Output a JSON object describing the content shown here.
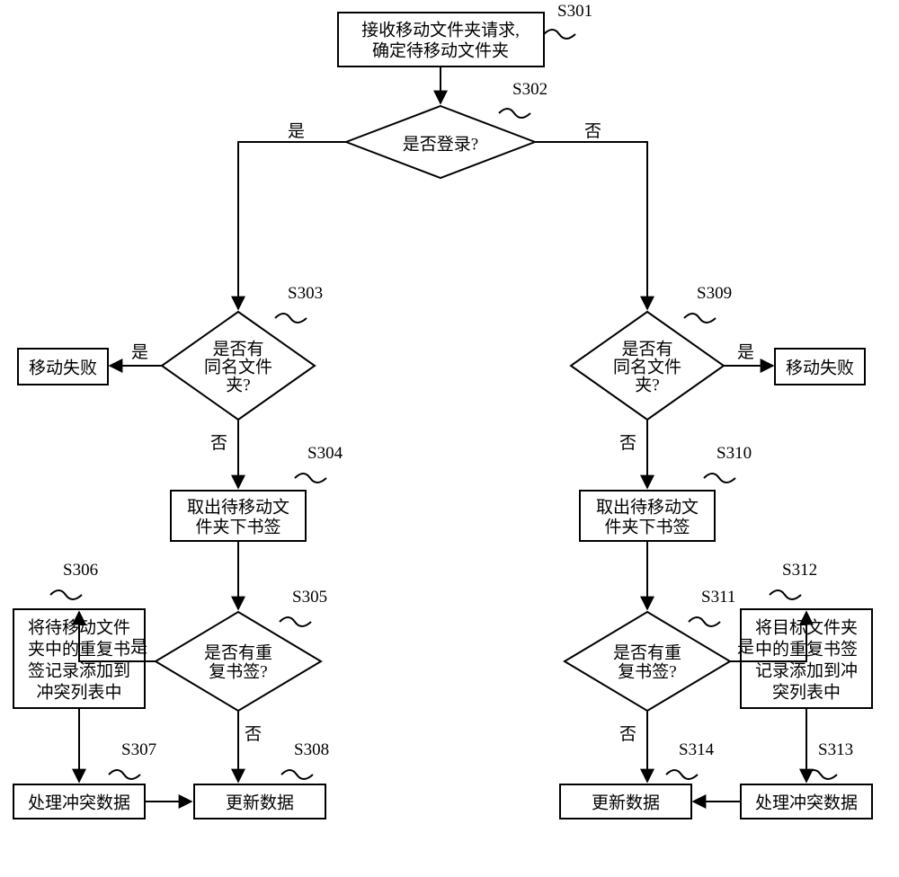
{
  "s301": {
    "label": "S301",
    "line1": "接收移动文件夹请求,",
    "line2": "确定待移动文件夹"
  },
  "s302": {
    "label": "S302",
    "text": "是否登录?"
  },
  "s303": {
    "label": "S303",
    "line1": "是否有",
    "line2": "同名文件",
    "line3": "夹?"
  },
  "s304": {
    "label": "S304",
    "line1": "取出待移动文",
    "line2": "件夹下书签"
  },
  "s305": {
    "label": "S305",
    "line1": "是否有重",
    "line2": "复书签?"
  },
  "s306": {
    "label": "S306",
    "line1": "将待移动文件",
    "line2": "夹中的重复书",
    "line3": "签记录添加到",
    "line4": "冲突列表中"
  },
  "s307": {
    "label": "S307",
    "text": "处理冲突数据"
  },
  "s308": {
    "label": "S308",
    "text": "更新数据"
  },
  "s309": {
    "label": "S309",
    "line1": "是否有",
    "line2": "同名文件",
    "line3": "夹?"
  },
  "s310": {
    "label": "S310",
    "line1": "取出待移动文",
    "line2": "件夹下书签"
  },
  "s311": {
    "label": "S311",
    "line1": "是否有重",
    "line2": "复书签?"
  },
  "s312": {
    "label": "S312",
    "line1": "将目标文件夹",
    "line2": "中的重复书签",
    "line3": "记录添加到冲",
    "line4": "突列表中"
  },
  "s313": {
    "label": "S313",
    "text": "处理冲突数据"
  },
  "s314": {
    "label": "S314",
    "text": "更新数据"
  },
  "moveFailLeft": "移动失败",
  "moveFailRight": "移动失败",
  "yes": "是",
  "no": "否"
}
